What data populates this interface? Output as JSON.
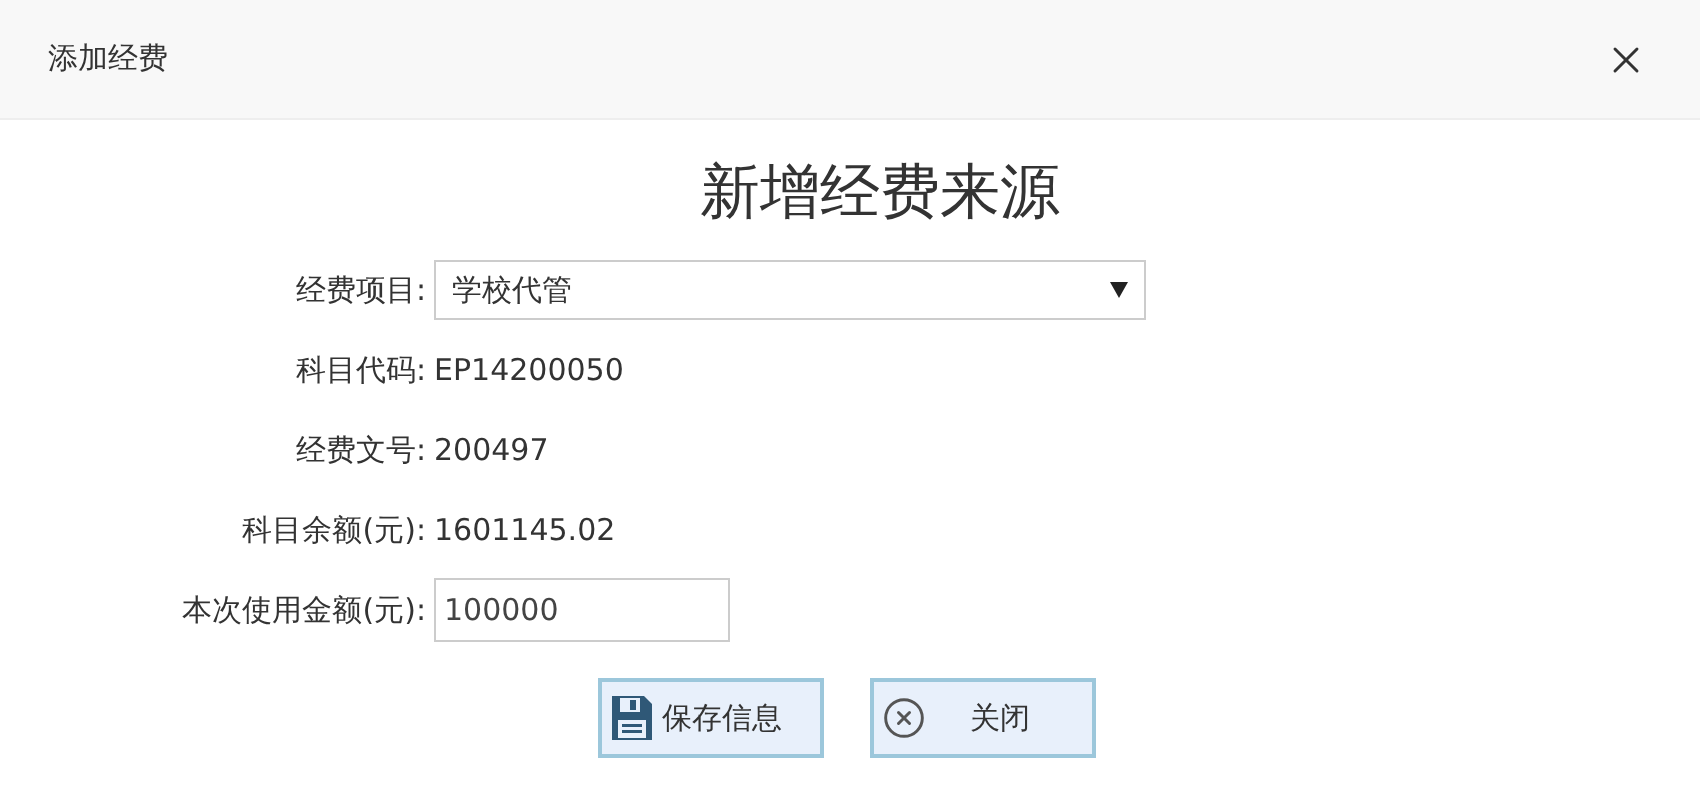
{
  "dialog": {
    "title": "添加经费"
  },
  "heading": "新增经费来源",
  "fields": [
    {
      "kind": "select",
      "label": "经费项目:",
      "value": "学校代管"
    },
    {
      "kind": "text",
      "label": "科目代码:",
      "value": "EP14200050"
    },
    {
      "kind": "text",
      "label": "经费文号:",
      "value": "200497"
    },
    {
      "kind": "text",
      "label": "科目余额(元):",
      "value": "1601145.02"
    },
    {
      "kind": "input",
      "label": "本次使用金额(元):",
      "value": "100000"
    }
  ],
  "buttons": [
    {
      "kind": "save",
      "label": "保存信息"
    },
    {
      "kind": "close",
      "label": "关闭"
    }
  ]
}
